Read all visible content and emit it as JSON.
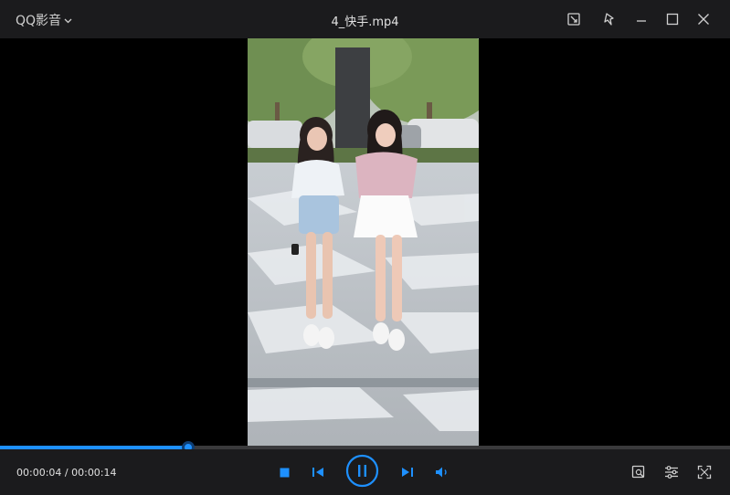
{
  "titlebar": {
    "app_name": "QQ影音",
    "file_title": "4_快手.mp4"
  },
  "playback": {
    "current_time": "00:00:04",
    "separator": " / ",
    "total_time": "00:00:14",
    "progress_percent": 25.8
  },
  "colors": {
    "accent": "#1e90ff",
    "titlebar_bg": "#1b1b1d",
    "video_bg": "#000000"
  },
  "icons": {
    "app_menu": "chevron-down-icon",
    "window_buttons": [
      "screenshot-icon",
      "pin-icon",
      "minimize-icon",
      "maximize-icon",
      "close-icon"
    ],
    "controls": [
      "stop-icon",
      "previous-icon",
      "pause-icon",
      "next-icon",
      "volume-icon"
    ],
    "right_controls": [
      "image-search-icon",
      "settings-sliders-icon",
      "fullscreen-icon"
    ]
  }
}
